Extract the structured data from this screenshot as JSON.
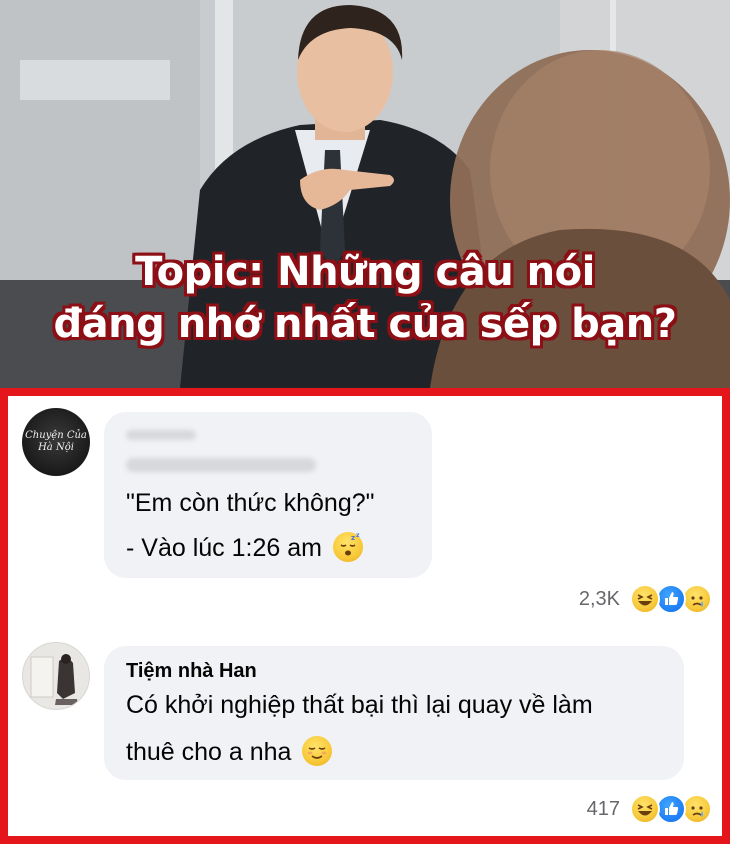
{
  "banner": {
    "title_line1": "Topic: Những câu nói",
    "title_line2": "đáng nhớ nhất của sếp bạn?"
  },
  "colors": {
    "frame": "#e4161b",
    "bubble": "#f0f2f5",
    "title_outline": "#8b0f14",
    "text": "#050505",
    "meta": "#65676b"
  },
  "comments": [
    {
      "author": "Chuyện của Hà Nội",
      "author_blurred": true,
      "avatar_text": "Chuyện Của Hà Nội",
      "line1": "\"Em còn thức không?\"",
      "line2": "- Vào lúc 1:26 am",
      "emoji": "sleeping-face-icon",
      "reaction_count": "2,3K",
      "reactions": [
        "haha-icon",
        "like-icon",
        "sad-icon"
      ]
    },
    {
      "author": "Tiệm nhà Han",
      "line1": "Có khởi nghiệp thất bại thì lại quay về làm",
      "line2": "thuê cho a nha",
      "emoji": "relieved-face-icon",
      "reaction_count": "417",
      "reactions": [
        "haha-icon",
        "like-icon",
        "sad-icon"
      ]
    }
  ]
}
